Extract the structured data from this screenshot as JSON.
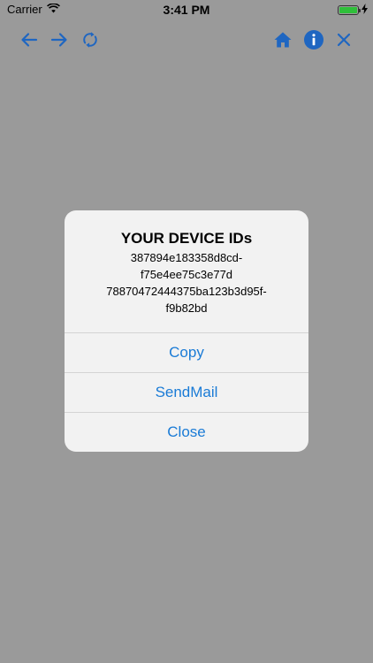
{
  "status_bar": {
    "carrier": "Carrier",
    "time": "3:41 PM",
    "battery_level": 1.0,
    "battery_color": "#2fbf3a"
  },
  "toolbar": {
    "icon_color": "#1f66c1",
    "left_icons": [
      "back-arrow-icon",
      "forward-arrow-icon",
      "refresh-icon"
    ],
    "right_icons": [
      "home-icon",
      "info-icon",
      "close-icon"
    ]
  },
  "alert": {
    "title": "YOUR DEVICE IDs",
    "message_lines": [
      "387894e183358d8cd-",
      "f75e4ee75c3e77d",
      "78870472444375ba123b3d95f-",
      "f9b82bd"
    ],
    "actions": [
      "Copy",
      "SendMail",
      "Close"
    ],
    "action_color": "#1a7bd6"
  }
}
